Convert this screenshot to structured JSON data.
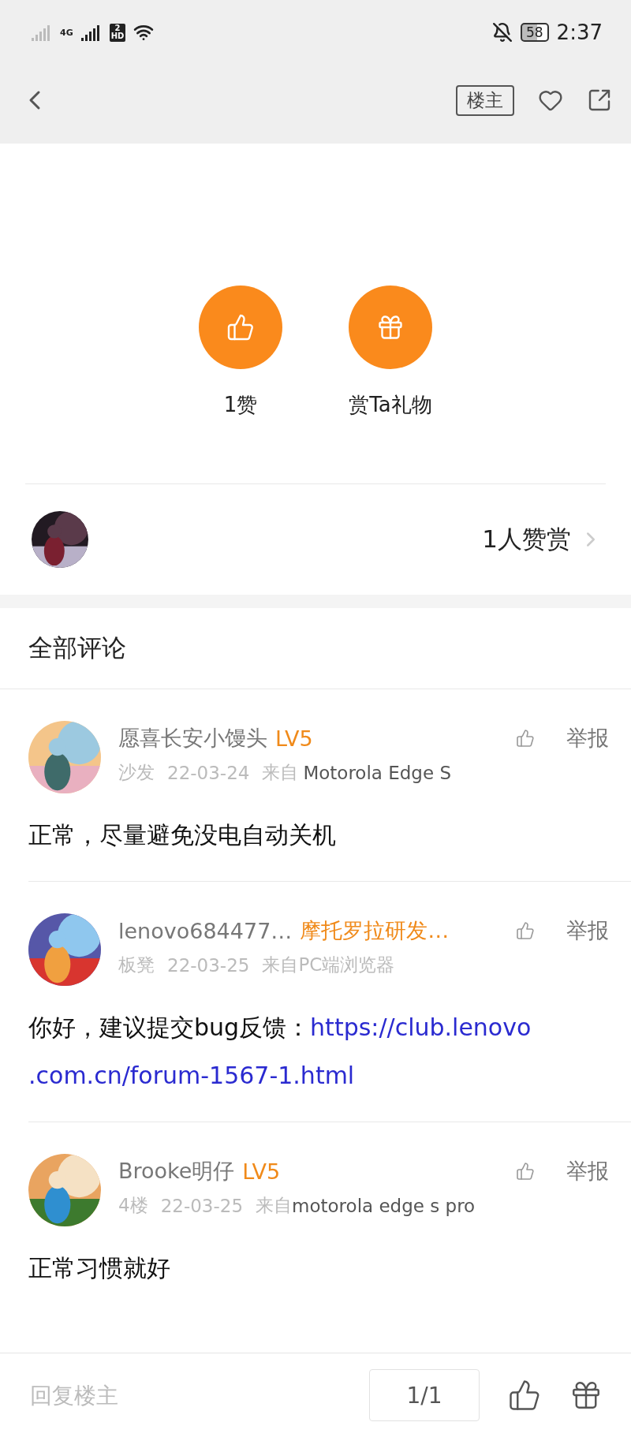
{
  "status_bar": {
    "network": "4G",
    "sim": "2",
    "hd": "HD",
    "battery": "58",
    "time": "2:37"
  },
  "header": {
    "op_button": "楼主"
  },
  "actions": [
    {
      "kind": "like",
      "label": "1赞"
    },
    {
      "kind": "gift",
      "label": "赏Ta礼物"
    }
  ],
  "rewards": {
    "label": "1人赞赏"
  },
  "comments_title": "全部评论",
  "comments": [
    {
      "name": "愿喜长安小馒头",
      "badge": "LV5",
      "floor": "沙发",
      "date": "22-03-24",
      "source": "来自",
      "device": "Motorola Edge S",
      "report": "举报",
      "body": [
        {
          "kind": "text",
          "text": "正常，尽量避免没电自动关机"
        }
      ]
    },
    {
      "name": "lenovo684477…",
      "badge": "摩托罗拉研发…",
      "floor": "板凳",
      "date": "22-03-25",
      "source": "来自PC端浏览器",
      "report": "举报",
      "body": [
        {
          "kind": "text",
          "text": "你好，建议提交bug反馈："
        },
        {
          "kind": "link",
          "text": "https://club.lenovo"
        },
        {
          "kind": "link",
          "text": ".com.cn/forum-1567-1.html"
        }
      ]
    },
    {
      "name": "Brooke明仔",
      "badge": "LV5",
      "floor": "4楼",
      "date": "22-03-25",
      "source": "来自",
      "device": "motorola edge s pro",
      "report": "举报",
      "body": [
        {
          "kind": "text",
          "text": "正常习惯就好"
        }
      ]
    }
  ],
  "bottom_bar": {
    "reply_placeholder": "回复楼主",
    "page": "1/1"
  }
}
